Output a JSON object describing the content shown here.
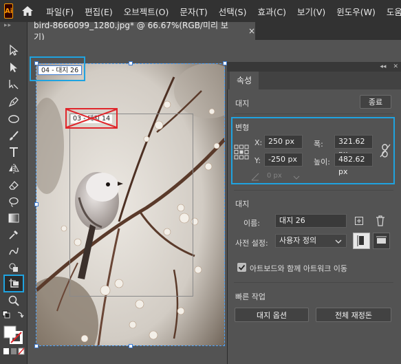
{
  "app": {
    "logo": "Ai"
  },
  "menu": [
    "파일(F)",
    "편집(E)",
    "오브젝트(O)",
    "문자(T)",
    "선택(S)",
    "효과(C)",
    "보기(V)",
    "윈도우(W)",
    "도움"
  ],
  "document_tab": {
    "title": "bird-8666099_1280.jpg* @ 66.67%(RGB/미리 보기)",
    "close": "×"
  },
  "toolbar": {
    "grip": "▸▸"
  },
  "canvas": {
    "artboard_label_04": "04 - 대지 26",
    "artboard_label_14": "03 - 대지 14"
  },
  "panel": {
    "collapse": "◂◂",
    "close": "✕",
    "tab": "속성",
    "section_label": "대지",
    "done_button": "종료",
    "transform": {
      "title": "변형",
      "x_label": "X:",
      "x_value": "250 px",
      "y_label": "Y:",
      "y_value": "-250 px",
      "w_label": "폭:",
      "w_value": "321.62 px",
      "h_label": "높이:",
      "h_value": "482.62 px",
      "angle_value": "0 px"
    },
    "artboard": {
      "title": "대지",
      "name_label": "이름:",
      "name_value": "대지 26",
      "preset_label": "사전 설정:",
      "preset_value": "사용자 정의",
      "move_artwork_label": "아트보드와 함께 아트워크 이동",
      "move_artwork_checked": true
    },
    "quick_actions": {
      "title": "빠른 작업",
      "artboard_options": "대지 옵션",
      "rearrange_all": "전체 재정돈"
    }
  },
  "colors": {
    "accent": "#1fa3e0",
    "alert": "#e0262b",
    "app_bg": "#535353"
  }
}
